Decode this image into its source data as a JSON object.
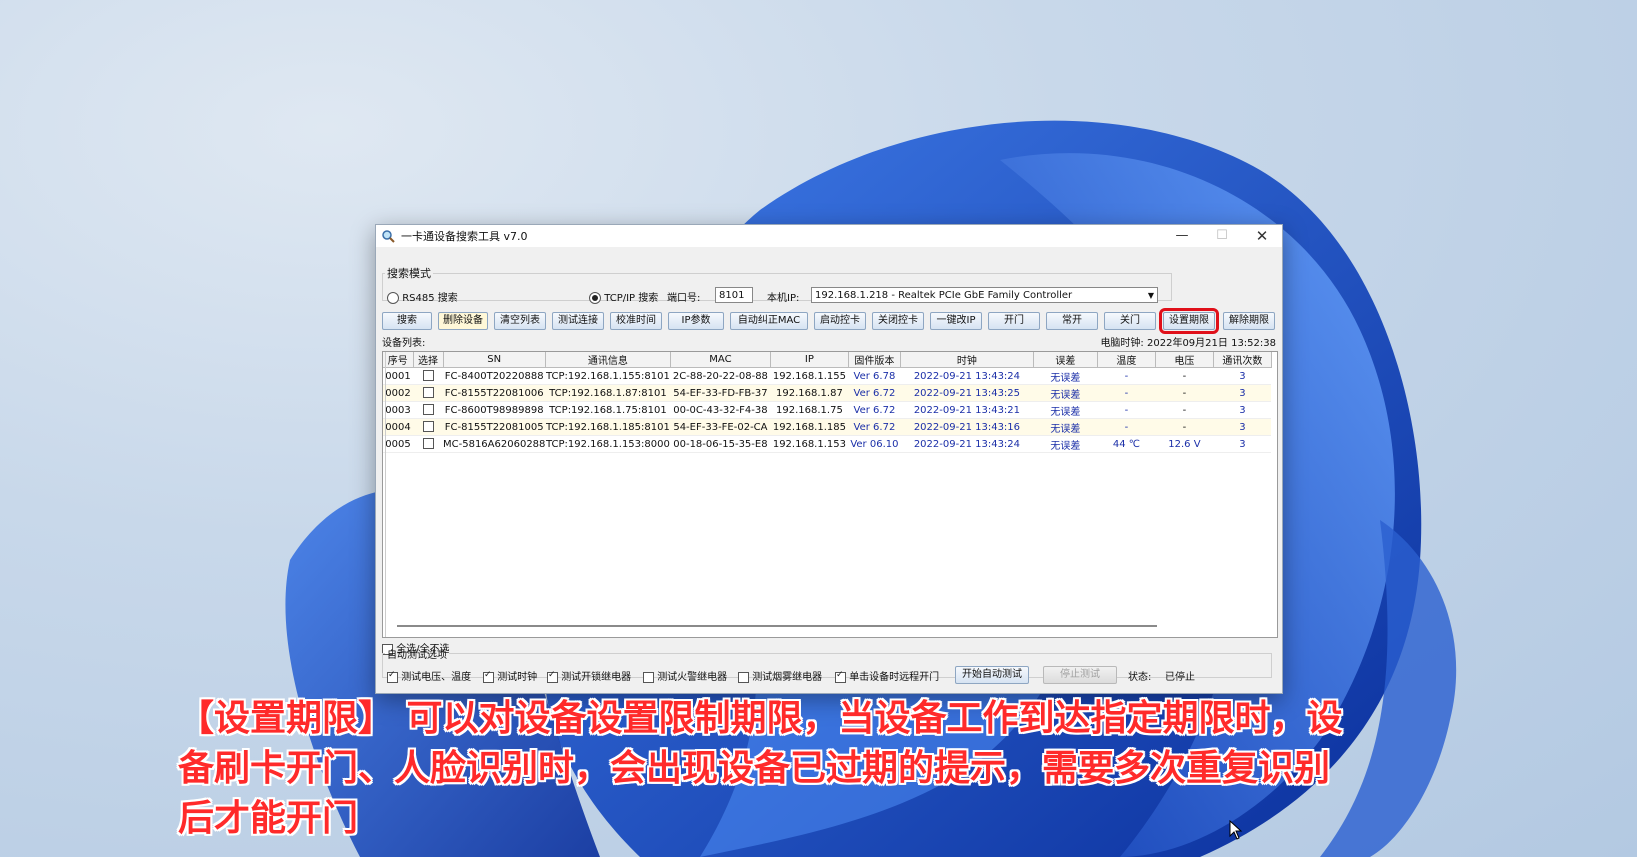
{
  "window": {
    "title": "一卡通设备搜索工具 v7.0",
    "minimize": "—",
    "maximize": "☐",
    "close": "✕"
  },
  "search_mode": {
    "legend": "搜索模式",
    "rs485_label": "RS485 搜索",
    "tcpip_label": "TCP/IP 搜索",
    "port_label": "端口号:",
    "port_value": "8101",
    "local_ip_label": "本机IP:",
    "local_ip_value": "192.168.1.218 - Realtek PCIe GbE Family Controller",
    "selected": "TCP/IP 搜索"
  },
  "toolbar": [
    "搜索",
    "删除设备",
    "清空列表",
    "测试连接",
    "校准时间",
    "IP参数",
    "自动纠正MAC",
    "启动控卡",
    "关闭控卡",
    "一键改IP",
    "开门",
    "常开",
    "关门",
    "设置期限",
    "解除期限"
  ],
  "device_list_label": "设备列表:",
  "pc_clock_label": "电脑时钟:",
  "pc_clock_value": "2022年09月21日 13:52:38",
  "columns": [
    "序号",
    "选择",
    "SN",
    "通讯信息",
    "MAC",
    "IP",
    "固件版本",
    "时钟",
    "误差",
    "温度",
    "电压",
    "通讯次数"
  ],
  "rows": [
    {
      "no": "0001",
      "sn": "FC-8400T20220888",
      "comm": "TCP:192.168.1.155:8101",
      "mac": "2C-88-20-22-08-88",
      "ip": "192.168.1.155",
      "fw_prefix": "Ver",
      "fw": "6.78",
      "clock": "2022-09-21 13:43:24",
      "err": "无误差",
      "temp": "-",
      "volt": "-",
      "count": "3"
    },
    {
      "no": "0002",
      "sn": "FC-8155T22081006",
      "comm": "TCP:192.168.1.87:8101",
      "mac": "54-EF-33-FD-FB-37",
      "ip": "192.168.1.87",
      "fw_prefix": "Ver",
      "fw": "6.72",
      "clock": "2022-09-21 13:43:25",
      "err": "无误差",
      "temp": "-",
      "volt": "-",
      "count": "3"
    },
    {
      "no": "0003",
      "sn": "FC-8600T98989898",
      "comm": "TCP:192.168.1.75:8101",
      "mac": "00-0C-43-32-F4-38",
      "ip": "192.168.1.75",
      "fw_prefix": "Ver",
      "fw": "6.72",
      "clock": "2022-09-21 13:43:21",
      "err": "无误差",
      "temp": "-",
      "volt": "-",
      "count": "3"
    },
    {
      "no": "0004",
      "sn": "FC-8155T22081005",
      "comm": "TCP:192.168.1.185:8101",
      "mac": "54-EF-33-FE-02-CA",
      "ip": "192.168.1.185",
      "fw_prefix": "Ver",
      "fw": "6.72",
      "clock": "2022-09-21 13:43:16",
      "err": "无误差",
      "temp": "-",
      "volt": "-",
      "count": "3"
    },
    {
      "no": "0005",
      "sn": "MC-5816A62060288",
      "comm": "TCP:192.168.1.153:8000",
      "mac": "00-18-06-15-35-E8",
      "ip": "192.168.1.153",
      "fw_prefix": "Ver",
      "fw": "06.10",
      "clock": "2022-09-21 13:43:24",
      "err": "无误差",
      "temp": "44 ℃",
      "volt": "12.6 V",
      "count": "3"
    }
  ],
  "select_all_label": "全选/全不选",
  "autotest": {
    "legend": "自动测试选项",
    "options": [
      {
        "label": "测试电压、温度",
        "checked": true
      },
      {
        "label": "测试时钟",
        "checked": true
      },
      {
        "label": "测试开锁继电器",
        "checked": true
      },
      {
        "label": "测试火警继电器",
        "checked": false
      },
      {
        "label": "测试烟雾继电器",
        "checked": false
      },
      {
        "label": "单击设备时远程开门",
        "checked": true
      }
    ],
    "start_button": "开始自动测试",
    "stop_button": "停止测试",
    "status_label": "状态:",
    "status_value": "已停止"
  },
  "subtitle": {
    "line1": "【设置期限】 可以对设备设置限制期限，当设备工作到达指定期限时，设",
    "line2": "备刷卡开门、人脸识别时，会出现设备已过期的提示，需要多次重复识别",
    "line3": "后才能开门"
  },
  "colors": {
    "highlight": "#e0101a",
    "subtitle": "#ff2a2a",
    "link_blue": "#1b2fa8"
  }
}
